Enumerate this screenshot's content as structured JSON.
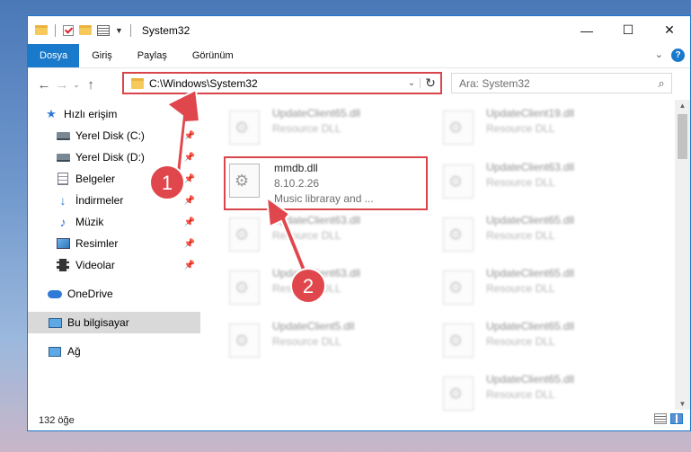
{
  "window": {
    "title": "System32"
  },
  "ribbon": {
    "tabs": [
      "Dosya",
      "Giriş",
      "Paylaş",
      "Görünüm"
    ],
    "help": "?"
  },
  "nav": {
    "back": "←",
    "forward": "→",
    "recent": "⌄",
    "up": "↑",
    "address": "C:\\Windows\\System32",
    "search_placeholder": "Ara: System32"
  },
  "sidebar": {
    "items": [
      {
        "label": "Hızlı erişim",
        "icon": "star-icon",
        "pinned": false
      },
      {
        "label": "Yerel Disk (C:)",
        "icon": "disk-icon",
        "pinned": true
      },
      {
        "label": "Yerel Disk (D:)",
        "icon": "disk-icon",
        "pinned": true
      },
      {
        "label": "Belgeler",
        "icon": "documents-icon",
        "pinned": true
      },
      {
        "label": "İndirmeler",
        "icon": "download-icon",
        "pinned": true
      },
      {
        "label": "Müzik",
        "icon": "music-icon",
        "pinned": true
      },
      {
        "label": "Resimler",
        "icon": "pictures-icon",
        "pinned": true
      },
      {
        "label": "Videolar",
        "icon": "videos-icon",
        "pinned": true
      },
      {
        "label": "OneDrive",
        "icon": "onedrive-icon",
        "pinned": false
      },
      {
        "label": "Bu bilgisayar",
        "icon": "this-pc-icon",
        "pinned": false,
        "selected": true
      },
      {
        "label": "Ağ",
        "icon": "network-icon",
        "pinned": false
      }
    ]
  },
  "files": {
    "left": [
      {
        "name": "UpdateClient65.dll",
        "type": "Resource DLL"
      },
      {
        "name": "mmdb.dll",
        "version": "8.10.2.26",
        "description": "Music libraray and ...",
        "highlighted": true
      },
      {
        "name": "UpdateClient63.dll",
        "type": "Resource DLL"
      },
      {
        "name": "UpdateClient63.dll",
        "type": "Resource DLL"
      },
      {
        "name": "UpdateClient5.dll",
        "type": "Resource DLL"
      }
    ],
    "right": [
      {
        "name": "UpdateClient19.dll",
        "type": "Resource DLL"
      },
      {
        "name": "UpdateClient63.dll",
        "type": "Resource DLL"
      },
      {
        "name": "UpdateClient65.dll",
        "type": "Resource DLL"
      },
      {
        "name": "UpdateClient65.dll",
        "type": "Resource DLL"
      },
      {
        "name": "UpdateClient65.dll",
        "type": "Resource DLL"
      },
      {
        "name": "UpdateClient65.dll",
        "type": "Resource DLL"
      }
    ]
  },
  "status": {
    "count": "132 öğe"
  },
  "callouts": {
    "step1": "1",
    "step2": "2"
  },
  "colors": {
    "accent": "#1979ca",
    "highlight": "#d9454a",
    "callout": "#e0474c"
  }
}
